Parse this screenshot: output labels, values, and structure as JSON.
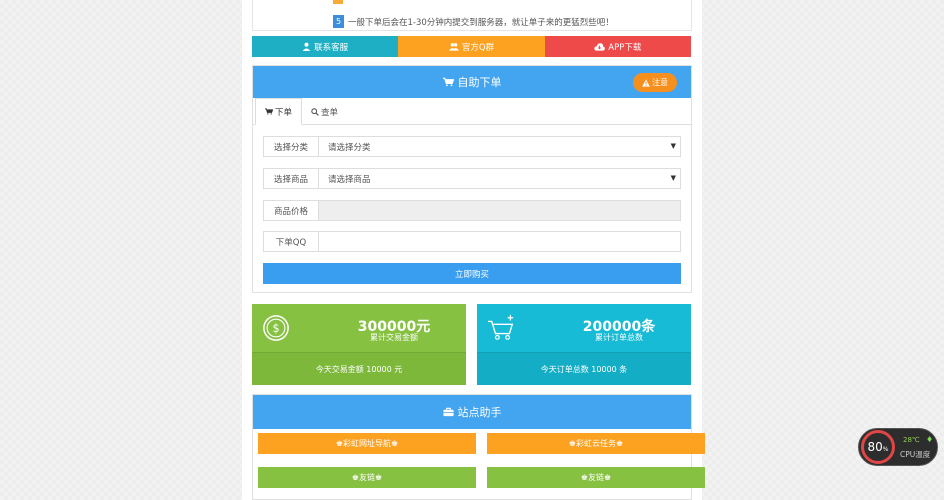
{
  "notice": {
    "num": "5",
    "text": "一般下单后会在1-30分钟内提交到服务器，就让单子来的更猛烈些吧！"
  },
  "quick_links": [
    {
      "label": "联系客服",
      "icon": "user-icon"
    },
    {
      "label": "官方Q群",
      "icon": "group-icon"
    },
    {
      "label": "APP下载",
      "icon": "cloud-download-icon"
    }
  ],
  "order_panel": {
    "title": "自助下单",
    "note_label": "注意",
    "tabs": [
      "下单",
      "查单"
    ],
    "fields": [
      {
        "label": "选择分类",
        "value": "请选择分类"
      },
      {
        "label": "选择商品",
        "value": "请选择商品"
      },
      {
        "label": "商品价格",
        "value": ""
      },
      {
        "label": "下单QQ",
        "value": ""
      }
    ],
    "buy_label": "立即购买"
  },
  "stats": [
    {
      "value": "300000元",
      "label": "累计交易金额",
      "today": "今天交易金额 10000 元",
      "color": "#86c142"
    },
    {
      "value": "200000条",
      "label": "累计订单总数",
      "today": "今天订单总数 10000 条",
      "color": "#17bbd5"
    }
  ],
  "helper": {
    "title": "站点助手",
    "buttons": [
      "彩虹网址导航",
      "彩虹云任务",
      "友链",
      "友链"
    ]
  },
  "cpu_widget": {
    "percent": "80",
    "unit": "%",
    "temp": "28℃",
    "label": "CPU温度"
  }
}
